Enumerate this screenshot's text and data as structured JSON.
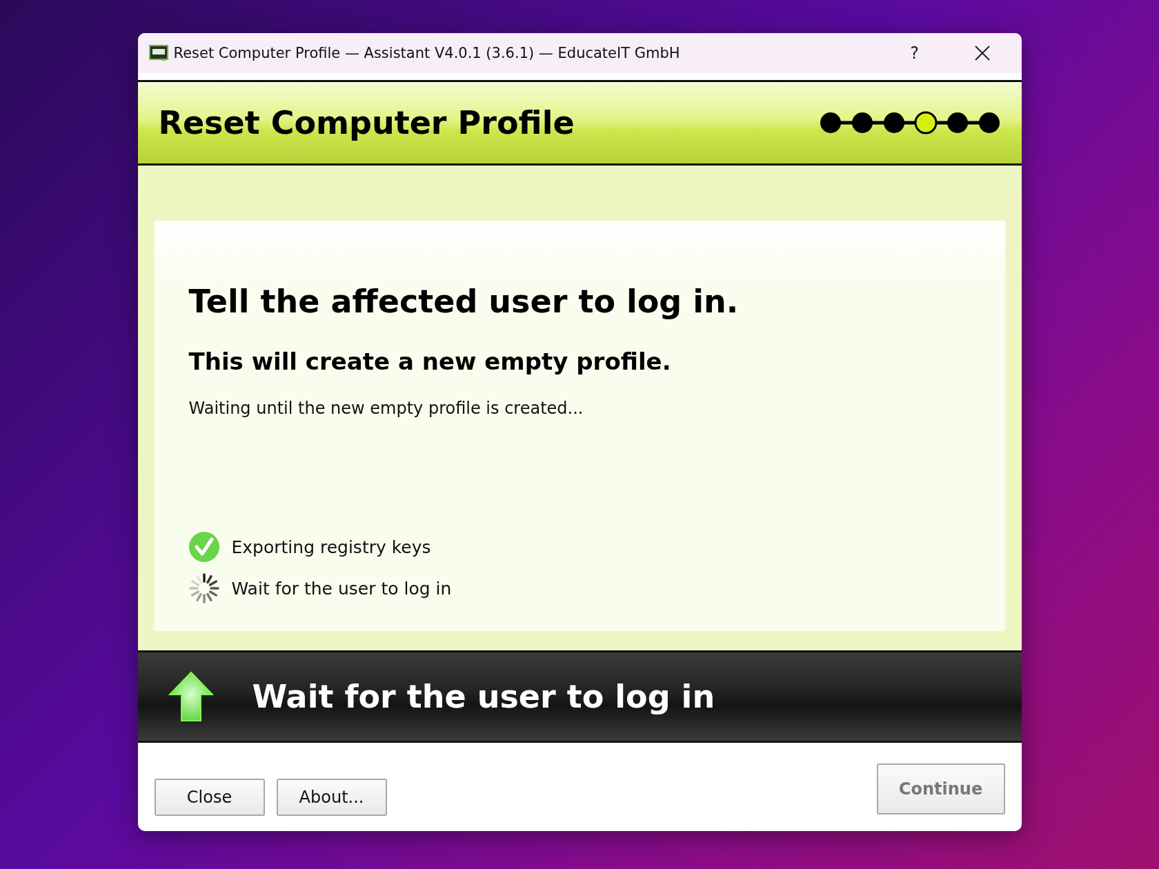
{
  "window": {
    "title": "Reset Computer Profile — Assistant V4.0.1 (3.6.1) — EducateIT GmbH",
    "help": "?"
  },
  "header": {
    "title": "Reset Computer Profile",
    "steps": [
      {
        "selected": false
      },
      {
        "selected": false
      },
      {
        "selected": false
      },
      {
        "selected": true
      },
      {
        "selected": false
      },
      {
        "selected": false
      }
    ]
  },
  "content": {
    "heading": "Tell the affected user to log in.",
    "subheading": "This will create a new empty profile.",
    "status": "Waiting until the new empty profile is created...",
    "tasks": [
      {
        "kind": "done",
        "label": "Exporting registry keys"
      },
      {
        "kind": "running",
        "label": "Wait for the user to log in"
      }
    ]
  },
  "banner": {
    "text": "Wait for the user to log in"
  },
  "buttons": [
    {
      "label": "Close",
      "disabled": false
    },
    {
      "label": "About...",
      "disabled": false
    }
  ],
  "continue_button": {
    "label": "Continue",
    "disabled": true
  }
}
